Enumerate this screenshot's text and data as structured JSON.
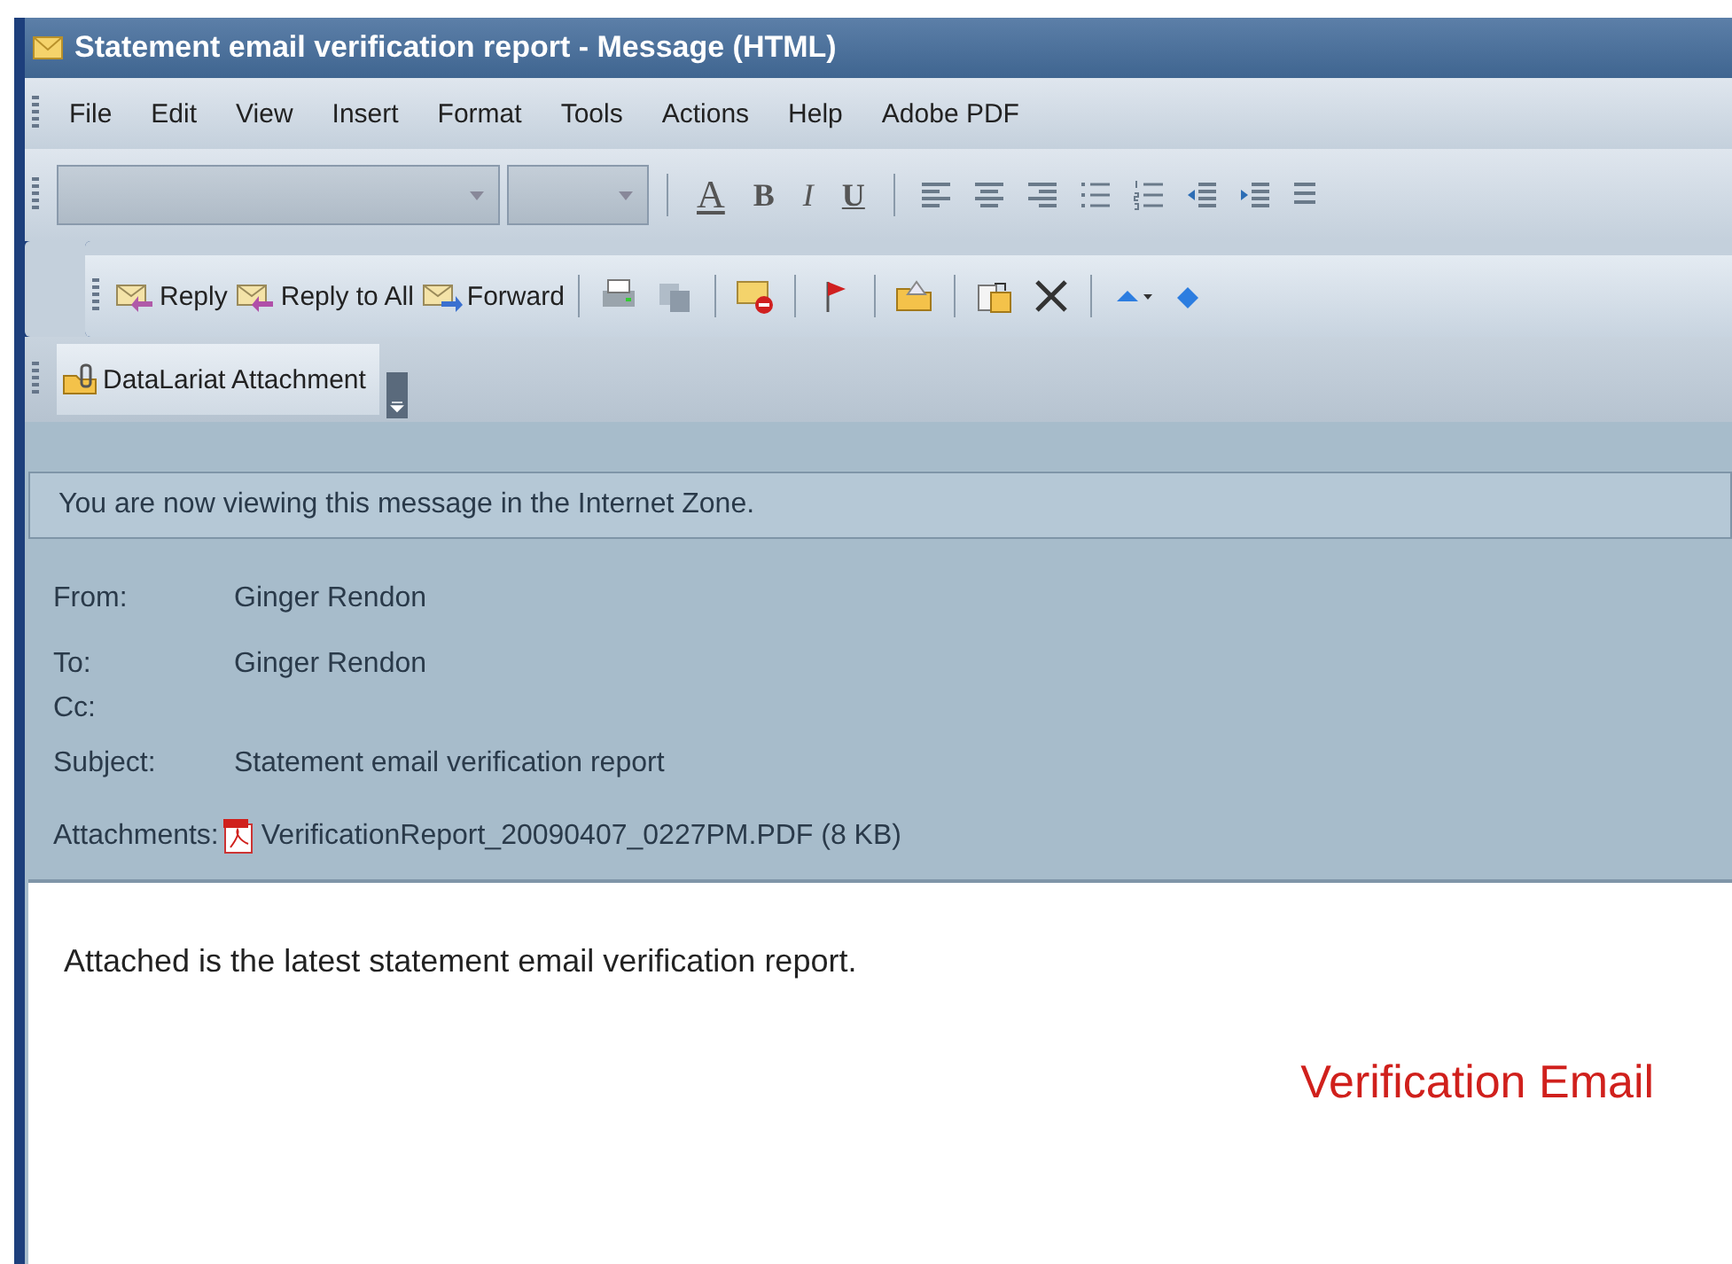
{
  "window": {
    "title": "Statement email verification report - Message (HTML)"
  },
  "menu": [
    "File",
    "Edit",
    "View",
    "Insert",
    "Format",
    "Tools",
    "Actions",
    "Help",
    "Adobe PDF"
  ],
  "format_toolbar": {
    "text_buttons": [
      {
        "label": "A",
        "kind": "color"
      },
      {
        "label": "B",
        "kind": "bold"
      },
      {
        "label": "I",
        "kind": "italic"
      },
      {
        "label": "U",
        "kind": "underline"
      }
    ],
    "icon_buttons": [
      {
        "kind": "align-left"
      },
      {
        "kind": "align-center"
      },
      {
        "kind": "align-right"
      },
      {
        "kind": "bullets"
      },
      {
        "kind": "numbering"
      },
      {
        "kind": "outdent"
      },
      {
        "kind": "indent"
      },
      {
        "kind": "style"
      }
    ]
  },
  "standard_toolbar": [
    {
      "kind": "reply",
      "label": "Reply"
    },
    {
      "kind": "reply-all",
      "label": "Reply to All"
    },
    {
      "kind": "forward",
      "label": "Forward"
    },
    {
      "kind": "print"
    },
    {
      "kind": "copy"
    },
    {
      "kind": "junk"
    },
    {
      "kind": "flag"
    },
    {
      "kind": "folder"
    },
    {
      "kind": "move"
    },
    {
      "kind": "delete"
    },
    {
      "kind": "up"
    },
    {
      "kind": "down"
    }
  ],
  "addin_toolbar": {
    "label": "DataLariat Attachment"
  },
  "info_bar": "You are now viewing this message in the Internet Zone.",
  "header": [
    {
      "label": "From:",
      "value": "Ginger Rendon"
    },
    {
      "label": "To:",
      "value": "Ginger Rendon"
    },
    {
      "label": "Cc:"
    },
    {
      "label": "Subject:",
      "value": "Statement email verification report"
    }
  ],
  "attachments": {
    "label": "Attachments:",
    "file": "VerificationReport_20090407_0227PM.PDF (8 KB)"
  },
  "body": {
    "text": "Attached is the latest statement email verification report.",
    "signature": "Verification Email"
  }
}
